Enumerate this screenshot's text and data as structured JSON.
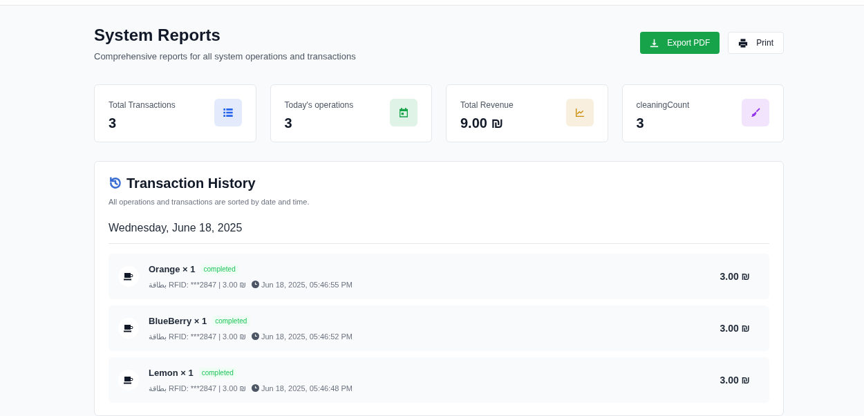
{
  "header": {
    "title": "System Reports",
    "subtitle": "Comprehensive reports for all system operations and transactions"
  },
  "actions": [
    {
      "label": "Export PDF",
      "kind": "primary"
    },
    {
      "label": "Print",
      "kind": "secondary"
    }
  ],
  "stats": [
    {
      "label": "Total Transactions",
      "value": "3",
      "kind": "list",
      "color": "#2563eb"
    },
    {
      "label": "Today's operations",
      "value": "3",
      "kind": "calendar",
      "color": "#16a34a"
    },
    {
      "label": "Total Revenue",
      "value": "9.00 ₪",
      "kind": "chart",
      "color": "#ca8a04"
    },
    {
      "label": "cleaningCount",
      "value": "3",
      "kind": "broom",
      "color": "#9333ea"
    }
  ],
  "history": {
    "title": "Transaction History",
    "subtitle": "All operations and transactions are sorted by date and time.",
    "date": "Wednesday, June 18, 2025",
    "transactions": [
      {
        "name": "Orange × 1",
        "status": "completed",
        "details": "بطاقة RFID: ***2847 | 3.00 ₪",
        "time": "Jun 18, 2025, 05:46:55 PM",
        "amount": "3.00 ₪"
      },
      {
        "name": "BlueBerry × 1",
        "status": "completed",
        "details": "بطاقة RFID: ***2847 | 3.00 ₪",
        "time": "Jun 18, 2025, 05:46:52 PM",
        "amount": "3.00 ₪"
      },
      {
        "name": "Lemon × 1",
        "status": "completed",
        "details": "بطاقة RFID: ***2847 | 3.00 ₪",
        "time": "Jun 18, 2025, 05:46:48 PM",
        "amount": "3.00 ₪"
      }
    ]
  }
}
